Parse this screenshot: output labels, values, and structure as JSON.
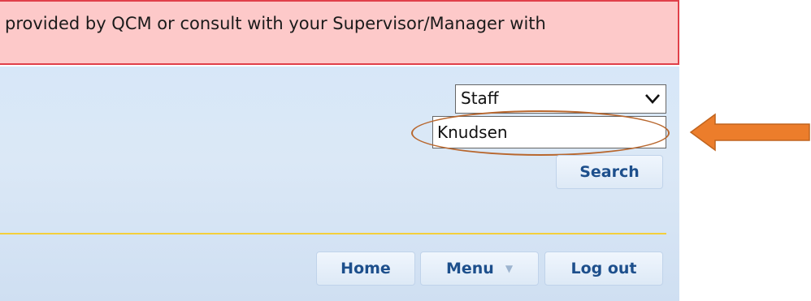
{
  "alert": {
    "text": "provided by QCM or consult with your Supervisor/Manager with"
  },
  "search": {
    "category_selected": "Staff",
    "query": "Knudsen",
    "button_label": "Search"
  },
  "nav": {
    "home_label": "Home",
    "menu_label": "Menu",
    "logout_label": "Log out"
  },
  "colors": {
    "alert_background": "#fdc9c9",
    "alert_border": "#e0404a",
    "panel_background": "#d7e7f8",
    "button_text": "#1d4f8c",
    "divider": "#f3cf3c",
    "annotation_orange": "#ec7d2b",
    "annotation_brown": "#b8672e"
  },
  "icons": {
    "select_chevron": "chevron-down-icon",
    "menu_caret": "caret-down-icon",
    "pointer": "arrow-left-icon"
  }
}
